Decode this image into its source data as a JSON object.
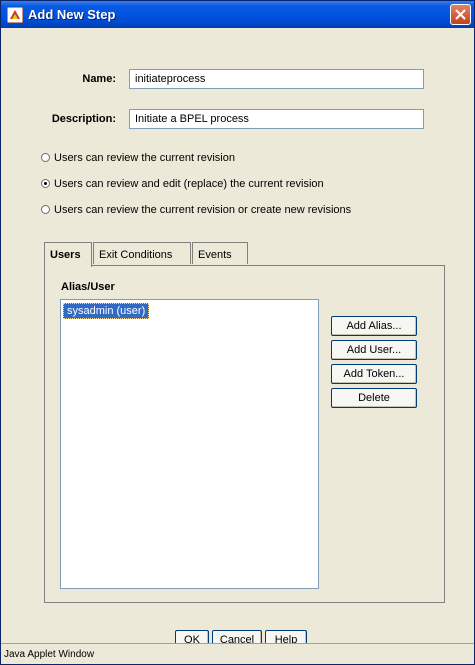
{
  "window": {
    "title": "Add New Step",
    "status_text": "Java Applet Window"
  },
  "form": {
    "name_label": "Name:",
    "name_value": "initiateprocess",
    "description_label": "Description:",
    "description_value": "Initiate a BPEL process"
  },
  "permissions": {
    "options": [
      {
        "label": "Users can review the current revision",
        "selected": false
      },
      {
        "label": "Users can review and edit (replace) the current revision",
        "selected": true
      },
      {
        "label": "Users can review the current revision or create new revisions",
        "selected": false
      }
    ]
  },
  "tabs": [
    {
      "label": "Users",
      "active": true
    },
    {
      "label": "Exit Conditions",
      "active": false
    },
    {
      "label": "Events",
      "active": false
    }
  ],
  "users_tab": {
    "list_header": "Alias/User",
    "items": [
      "sysadmin (user)"
    ],
    "buttons": {
      "add_alias": "Add Alias...",
      "add_user": "Add User...",
      "add_token": "Add Token...",
      "delete": "Delete"
    }
  },
  "footer": {
    "ok": "OK",
    "cancel": "Cancel",
    "help": "Help"
  },
  "colors": {
    "title_bar": "#0054e3",
    "selection": "#316ac5",
    "dialog_bg": "#ece9d8"
  }
}
